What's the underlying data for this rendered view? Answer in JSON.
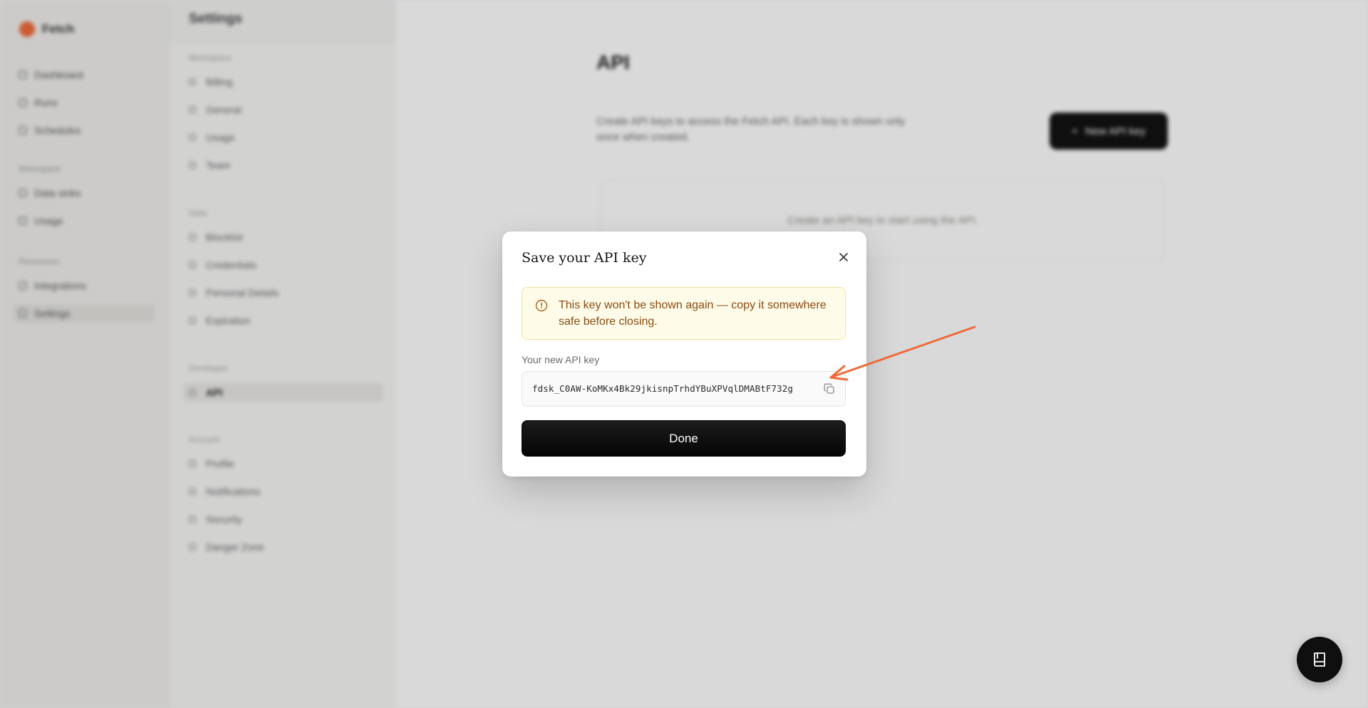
{
  "background": {
    "brand_name": "Fetch",
    "sidebar": {
      "top_items": [
        "Dashboard",
        "Runs",
        "Schedules"
      ],
      "group_a_heading": "Workspace",
      "group_a_items": [
        "Data sinks",
        "Usage"
      ],
      "group_b_heading": "Resources",
      "group_b_items": [
        "Integrations",
        "Settings"
      ]
    },
    "settings_nav": {
      "title": "Settings",
      "sections": [
        {
          "heading": "Workspace",
          "items": [
            "Billing",
            "General",
            "Usage",
            "Team"
          ]
        },
        {
          "heading": "Data",
          "items": [
            "Blocklist",
            "Credentials",
            "Personal Details",
            "Expiration"
          ]
        },
        {
          "heading": "Developer",
          "items": [
            "API"
          ]
        },
        {
          "heading": "Account",
          "items": [
            "Profile",
            "Notifications",
            "Security",
            "Danger Zone"
          ]
        }
      ],
      "active_item": "API"
    },
    "main": {
      "title": "API",
      "description": "Create API keys to access the Fetch API. Each key is shown only once when created.",
      "create_label": "New API key",
      "empty_text": "Create an API key to start using the API."
    }
  },
  "modal": {
    "title": "Save your API key",
    "warning": "This key won't be shown again — copy it somewhere safe before closing.",
    "field_label": "Your new API key",
    "api_key": "fdsk_C0AW-KoMKx4Bk29jkisnpTrhdYBuXPVqlDMABtF732g",
    "done_label": "Done"
  },
  "colors": {
    "accent_arrow": "#f06a3a",
    "warning_bg": "#fefbe8",
    "warning_text": "#8a4b12",
    "primary_button": "#0a0a0a"
  },
  "icons": {
    "close": "close-icon",
    "warning": "info-circle-icon",
    "copy": "copy-icon",
    "help": "book-icon"
  }
}
